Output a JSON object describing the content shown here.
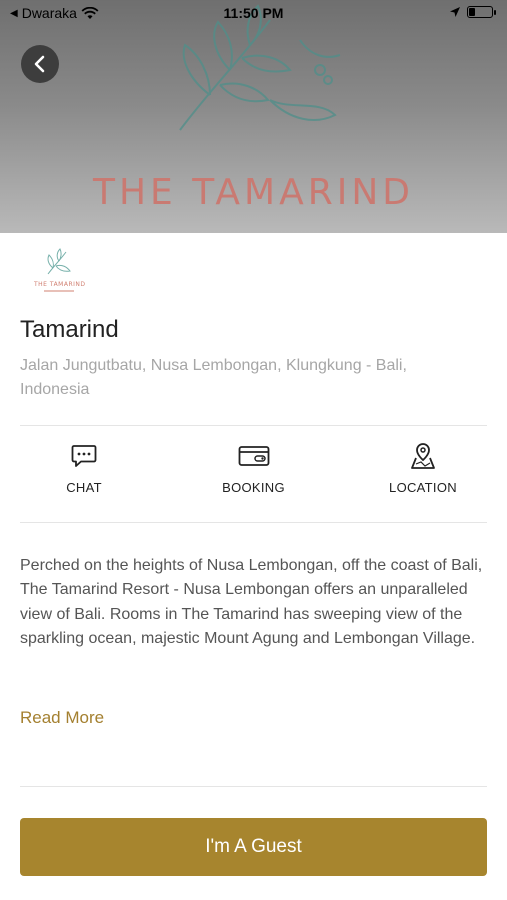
{
  "status_bar": {
    "carrier": "Dwaraka",
    "time": "11:50 PM"
  },
  "banner": {
    "title": "THE TAMARIND",
    "title_color": "#c97a72"
  },
  "hotel": {
    "name": "Tamarind",
    "address": "Jalan Jungutbatu, Nusa Lembongan, Klungkung - Bali, Indonesia",
    "logo_text": "THE TAMARIND"
  },
  "actions": [
    {
      "label": "CHAT",
      "icon": "chat-icon"
    },
    {
      "label": "BOOKING",
      "icon": "card-icon"
    },
    {
      "label": "LOCATION",
      "icon": "map-pin-icon"
    }
  ],
  "description": "Perched on the heights of Nusa Lembongan, off the coast of Bali, The Tamarind Resort - Nusa Lembongan offers an unparalleled view of Bali. Rooms in The Tamarind has sweeping view of the sparkling ocean, majestic Mount Agung and Lembongan Village.",
  "read_more": "Read More",
  "primary_button": {
    "label": "I'm A Guest",
    "color": "#a7852e"
  }
}
